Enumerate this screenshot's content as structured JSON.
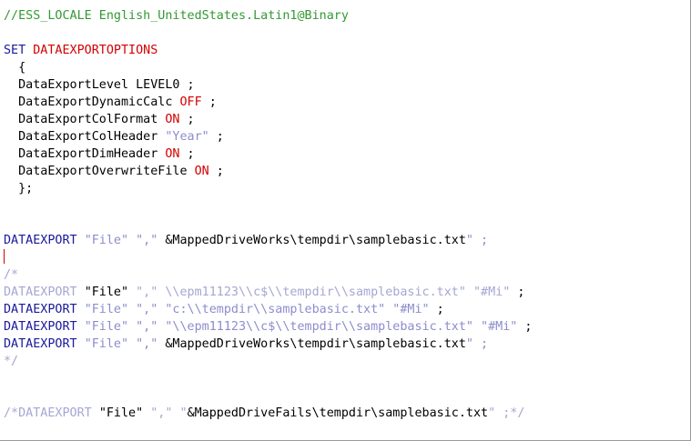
{
  "editor": {
    "lines": [
      [
        {
          "t": "//ESS_LOCALE English_UnitedStates.Latin1@Binary",
          "c": "comment"
        }
      ],
      [],
      [
        {
          "t": "SET ",
          "c": "kw"
        },
        {
          "t": "DATAEXPORTOPTIONS",
          "c": "opt"
        }
      ],
      [
        {
          "t": "  {",
          "c": "plain"
        }
      ],
      [
        {
          "t": "  DataExportLevel LEVEL0 ;",
          "c": "plain"
        }
      ],
      [
        {
          "t": "  DataExportDynamicCalc ",
          "c": "plain"
        },
        {
          "t": "OFF",
          "c": "opt"
        },
        {
          "t": " ;",
          "c": "plain"
        }
      ],
      [
        {
          "t": "  DataExportColFormat ",
          "c": "plain"
        },
        {
          "t": "ON",
          "c": "opt"
        },
        {
          "t": " ;",
          "c": "plain"
        }
      ],
      [
        {
          "t": "  DataExportColHeader ",
          "c": "plain"
        },
        {
          "t": "\"Year\"",
          "c": "str"
        },
        {
          "t": " ;",
          "c": "plain"
        }
      ],
      [
        {
          "t": "  DataExportDimHeader ",
          "c": "plain"
        },
        {
          "t": "ON",
          "c": "opt"
        },
        {
          "t": " ;",
          "c": "plain"
        }
      ],
      [
        {
          "t": "  DataExportOverwriteFile ",
          "c": "plain"
        },
        {
          "t": "ON",
          "c": "opt"
        },
        {
          "t": " ;",
          "c": "plain"
        }
      ],
      [
        {
          "t": "  };",
          "c": "plain"
        }
      ],
      [],
      [],
      [
        {
          "t": "DATAEXPORT ",
          "c": "kw"
        },
        {
          "t": "\"File\" \",\"",
          "c": "str"
        },
        {
          "t": " &MappedDriveWorks\\tempdir\\samplebasic.txt",
          "c": "plain"
        },
        {
          "t": "\" ;",
          "c": "str"
        }
      ],
      [
        {
          "t": "",
          "c": "caret"
        }
      ],
      [
        {
          "t": "/*",
          "c": "cmt"
        }
      ],
      [
        {
          "t": "DATAEXPORT ",
          "c": "cmt"
        },
        {
          "t": "\"File\"",
          "c": "plain"
        },
        {
          "t": " \",\" \\\\epm11123\\\\c$\\\\tempdir\\\\samplebasic.txt\" \"#Mi\"",
          "c": "cmt"
        },
        {
          "t": " ;",
          "c": "plain"
        }
      ],
      [
        {
          "t": "DATAEXPORT ",
          "c": "kw"
        },
        {
          "t": "\"File\" \",\" \"c:\\\\tempdir\\\\samplebasic.txt\" \"#Mi\"",
          "c": "str"
        },
        {
          "t": " ;",
          "c": "plain"
        }
      ],
      [
        {
          "t": "DATAEXPORT ",
          "c": "kw"
        },
        {
          "t": "\"File\" \",\" \"\\\\epm11123\\\\c$\\\\tempdir\\\\samplebasic.txt\" \"#Mi\"",
          "c": "str"
        },
        {
          "t": " ;",
          "c": "plain"
        }
      ],
      [
        {
          "t": "DATAEXPORT ",
          "c": "kw"
        },
        {
          "t": "\"File\" \",\"",
          "c": "str"
        },
        {
          "t": " &MappedDriveWorks\\tempdir\\samplebasic.txt",
          "c": "plain"
        },
        {
          "t": "\" ;",
          "c": "str"
        }
      ],
      [
        {
          "t": "*/",
          "c": "cmt"
        }
      ],
      [],
      [],
      [
        {
          "t": "/*DATAEXPORT ",
          "c": "cmt"
        },
        {
          "t": "\"File\"",
          "c": "plain"
        },
        {
          "t": " \",\" \"",
          "c": "cmt"
        },
        {
          "t": "&MappedDriveFails\\tempdir\\samplebasic.txt",
          "c": "plain"
        },
        {
          "t": "\" ;*/",
          "c": "cmt"
        }
      ]
    ]
  }
}
